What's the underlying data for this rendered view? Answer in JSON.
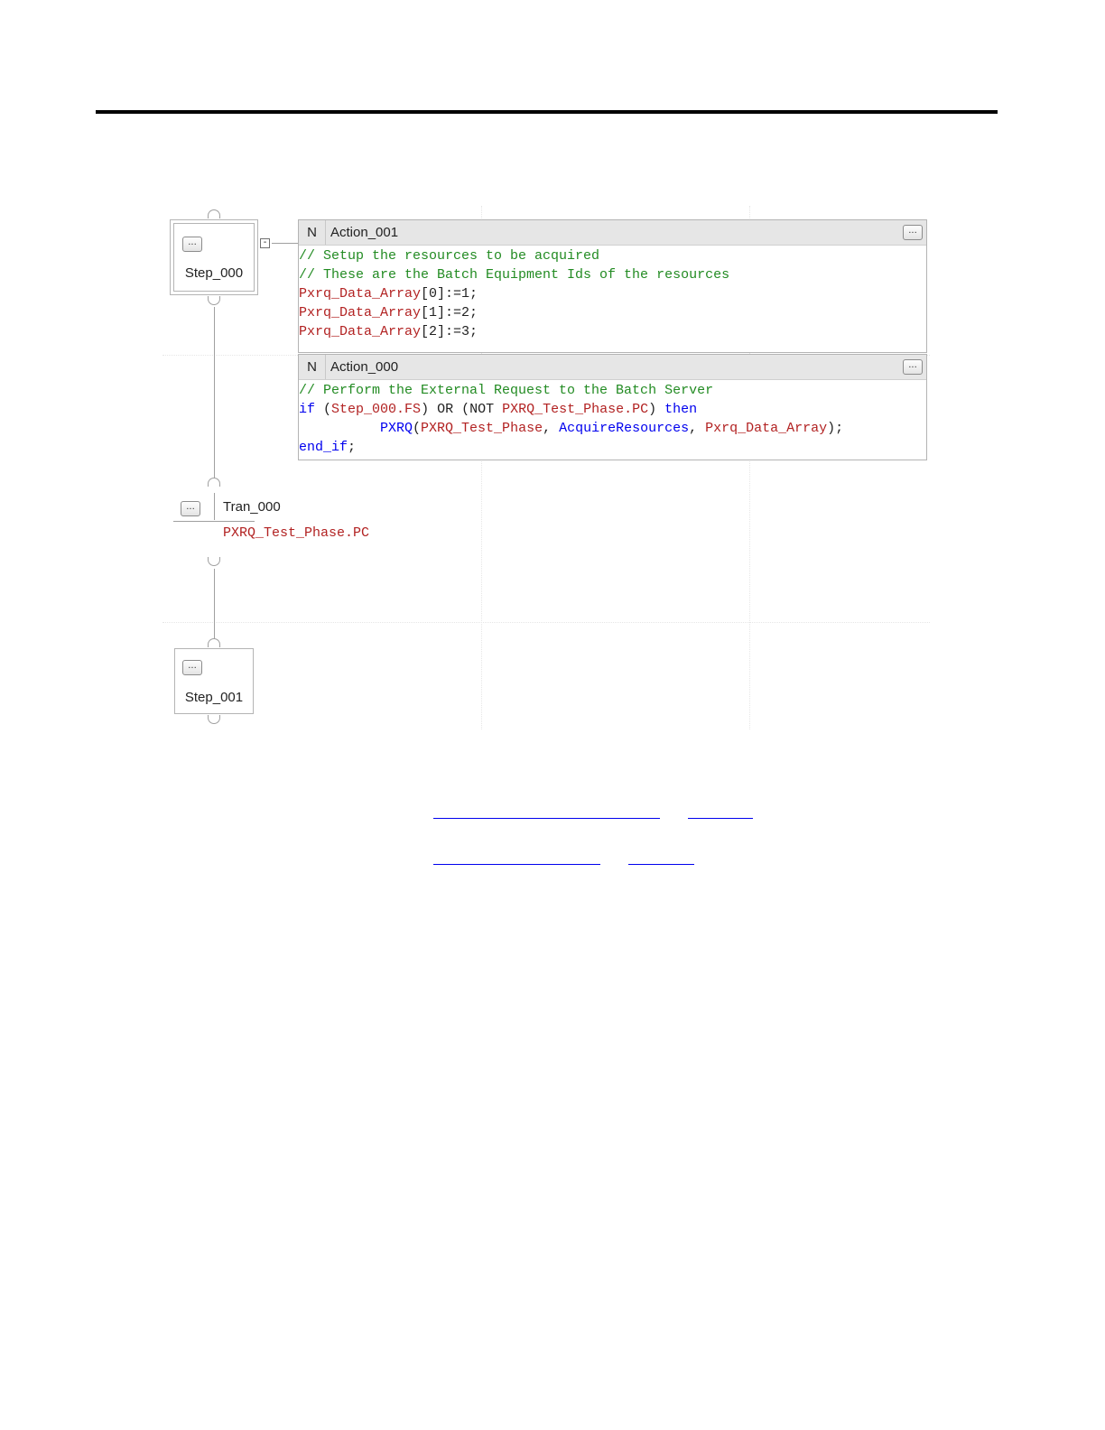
{
  "actions": [
    {
      "qualifier": "N",
      "name": "Action_001",
      "button": "...",
      "lines": [
        [
          {
            "t": "// Setup the resources to be acquired",
            "c": "com"
          }
        ],
        [
          {
            "t": "// These are the Batch Equipment Ids of the resources",
            "c": "com"
          }
        ],
        [
          {
            "t": "Pxrq_Data_Array",
            "c": "var"
          },
          {
            "t": "[0]:=1;",
            "c": "txt"
          }
        ],
        [
          {
            "t": "Pxrq_Data_Array",
            "c": "var"
          },
          {
            "t": "[1]:=2;",
            "c": "txt"
          }
        ],
        [
          {
            "t": "Pxrq_Data_Array",
            "c": "var"
          },
          {
            "t": "[2]:=3;",
            "c": "txt"
          }
        ]
      ]
    },
    {
      "qualifier": "N",
      "name": "Action_000",
      "button": "...",
      "lines": [
        [
          {
            "t": "// Perform the External Request to the Batch Server",
            "c": "com"
          }
        ],
        [
          {
            "t": "if",
            "c": "kw"
          },
          {
            "t": " (",
            "c": "txt"
          },
          {
            "t": "Step_000.FS",
            "c": "var"
          },
          {
            "t": ") OR (NOT ",
            "c": "txt"
          },
          {
            "t": "PXRQ_Test_Phase.PC",
            "c": "var"
          },
          {
            "t": ") ",
            "c": "txt"
          },
          {
            "t": "then",
            "c": "kw"
          }
        ],
        [
          {
            "t": "          ",
            "c": "txt"
          },
          {
            "t": "PXRQ",
            "c": "kw"
          },
          {
            "t": "(",
            "c": "txt"
          },
          {
            "t": "PXRQ_Test_Phase",
            "c": "var"
          },
          {
            "t": ", ",
            "c": "txt"
          },
          {
            "t": "AcquireResources",
            "c": "kw"
          },
          {
            "t": ", ",
            "c": "txt"
          },
          {
            "t": "Pxrq_Data_Array",
            "c": "var"
          },
          {
            "t": ");",
            "c": "txt"
          }
        ],
        [
          {
            "t": "end_if",
            "c": "kw"
          },
          {
            "t": ";",
            "c": "txt"
          }
        ]
      ]
    }
  ],
  "steps": {
    "step0": {
      "label": "Step_000",
      "button": "..."
    },
    "step1": {
      "label": "Step_001",
      "button": "..."
    }
  },
  "transition": {
    "name": "Tran_000",
    "condition": "PXRQ_Test_Phase.PC",
    "button": "..."
  },
  "collapse": {
    "symbol": "-"
  },
  "colors": {
    "comment": "#228b22",
    "variable": "#b22222",
    "keyword": "#0000ee",
    "link": "#0000ee",
    "wire": "#a0a0a0"
  }
}
